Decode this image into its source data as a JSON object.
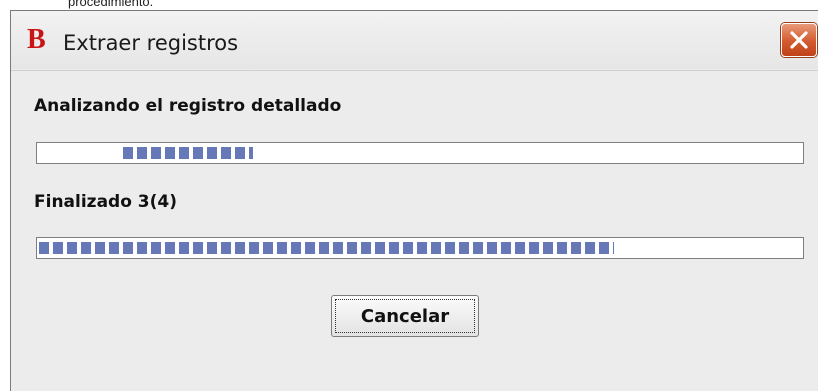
{
  "background": {
    "partial_text": "procedimiento."
  },
  "dialog": {
    "logo": "B",
    "title": "Extraer registros",
    "close_icon": "close-icon",
    "status_label": "Analizando el registro detallado",
    "status_progress_fraction": 0.17,
    "total_label": "Finalizado 3(4)",
    "total_progress_fraction": 0.75,
    "cancel_label": "Cancelar"
  },
  "colors": {
    "progress_fill": "#6678b8",
    "close_button": "#d35a2f",
    "logo": "#c81414"
  }
}
